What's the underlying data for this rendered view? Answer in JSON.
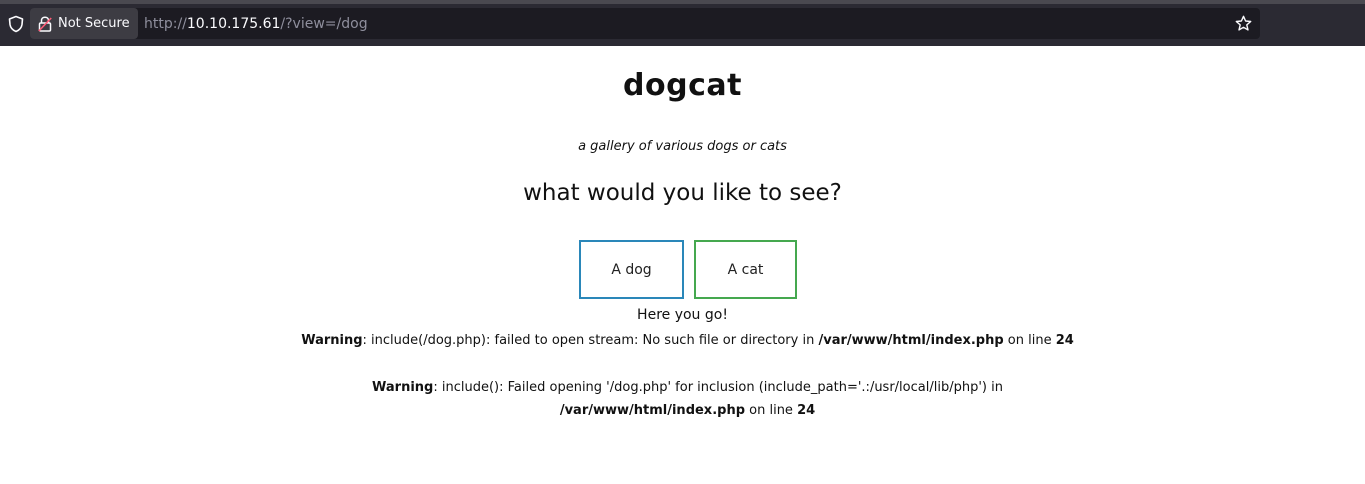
{
  "browser": {
    "security_label": "Not Secure",
    "url_prefix": "http://",
    "url_host": "10.10.175.61",
    "url_path": "/?view=/dog"
  },
  "page": {
    "title": "dogcat",
    "subtitle": "a gallery of various dogs or cats",
    "question": "what would you like to see?",
    "buttons": {
      "dog": "A dog",
      "cat": "A cat"
    },
    "result": "Here you go!",
    "warning1": {
      "label": "Warning",
      "message": ": include(/dog.php): failed to open stream: No such file or directory in ",
      "file": "/var/www/html/index.php",
      "on_line": " on line ",
      "line": "24"
    },
    "warning2": {
      "label": "Warning",
      "message": ": include(): Failed opening '/dog.php' for inclusion (include_path='.:/usr/local/lib/php') in ",
      "file": "/var/www/html/index.php",
      "on_line": " on line ",
      "line": "24"
    }
  },
  "colors": {
    "dog_button_border": "#2a87b9",
    "cat_button_border": "#45a84f",
    "chrome_background": "#2b2a33"
  }
}
